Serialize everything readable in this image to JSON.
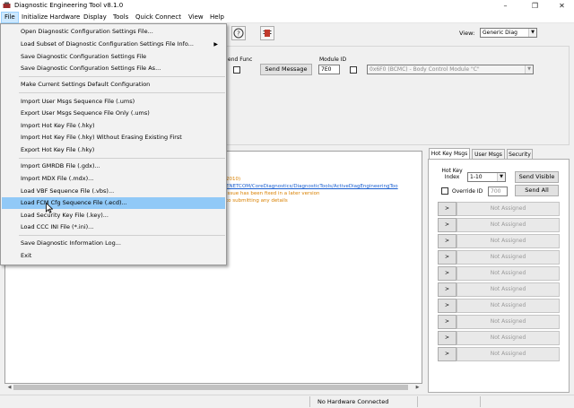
{
  "window": {
    "title": "Diagnostic Engineering Tool v8.1.0",
    "minimize": "–",
    "maximize": "❐",
    "close": "✕"
  },
  "menubar": [
    "File",
    "Initialize Hardware",
    "Display",
    "Tools",
    "Quick Connect",
    "View",
    "Help"
  ],
  "file_menu": [
    {
      "label": "Open Diagnostic Configuration Settings File...",
      "submenu": false
    },
    {
      "label": "Load Subset of Diagnostic Configuration Settings File Info...",
      "submenu": true
    },
    {
      "label": "Save Diagnostic Configuration Settings File",
      "submenu": false
    },
    {
      "label": "Save Diagnostic Configuration Settings File As...",
      "submenu": false
    },
    {
      "label": "Make Current Settings Default Configuration",
      "submenu": false
    },
    {
      "label": "Import User Msgs Sequence File (.ums)",
      "submenu": false
    },
    {
      "label": "Export User Msgs Sequence File Only (.ums)",
      "submenu": false
    },
    {
      "label": "Import Hot Key File (.hky)",
      "submenu": false
    },
    {
      "label": "Import Hot Key File (.hky) Without Erasing Existing First",
      "submenu": false
    },
    {
      "label": "Export Hot Key File (.hky)",
      "submenu": false
    },
    {
      "label": "Import GMRDB File (.gdx)...",
      "submenu": false
    },
    {
      "label": "Import MDX File (.mdx)...",
      "submenu": false
    },
    {
      "label": "Load VBF Sequence File (.vbs)...",
      "submenu": false
    },
    {
      "label": "Load FCM Cfg Sequence File (.ecd)...",
      "submenu": false,
      "highlighted": true
    },
    {
      "label": "Load Security Key File (.key)...",
      "submenu": false
    },
    {
      "label": "Load CCC INI File (*.ini)...",
      "submenu": false
    },
    {
      "label": "Save Diagnostic Information Log...",
      "submenu": false
    },
    {
      "label": "Exit",
      "submenu": false
    }
  ],
  "toolbar": {
    "view_label": "View:",
    "view_value": "Generic Diag",
    "help_icon": "help-icon",
    "hardware_icon": "chip-icon"
  },
  "config": {
    "send_func_label": "end Func",
    "send_message_label": "Send Message",
    "module_id_label": "Module ID",
    "module_id_value": "7E0",
    "module_select": "0x6F0 (BCMC) - Body Control Module \"C\""
  },
  "log": {
    "line1": "2010)",
    "line2": "ENETCOM/CoreDiagnostics/DiagnosticTools/ActiveDiagEngineeringToo",
    "line3": "issue has been fixed in a later version",
    "line4": "to submitting any details"
  },
  "hotkeys": {
    "tabs": [
      "Hot Key Msgs",
      "User Msgs",
      "Security"
    ],
    "hot_key_index_label": "Hot Key Index",
    "hot_key_index_value": "1-10",
    "send_visible": "Send Visible",
    "send_all": "Send All",
    "override_id_label": "Override ID",
    "override_id_value": "700",
    "send_symbol": ">",
    "slots": [
      "Not Assigned",
      "Not Assigned",
      "Not Assigned",
      "Not Assigned",
      "Not Assigned",
      "Not Assigned",
      "Not Assigned",
      "Not Assigned",
      "Not Assigned",
      "Not Assigned"
    ]
  },
  "status": {
    "hardware": "No Hardware Connected"
  },
  "colors": {
    "menu_highlight": "#91c9f7",
    "log_link": "#1a5fd0",
    "log_warning": "#d98000"
  }
}
